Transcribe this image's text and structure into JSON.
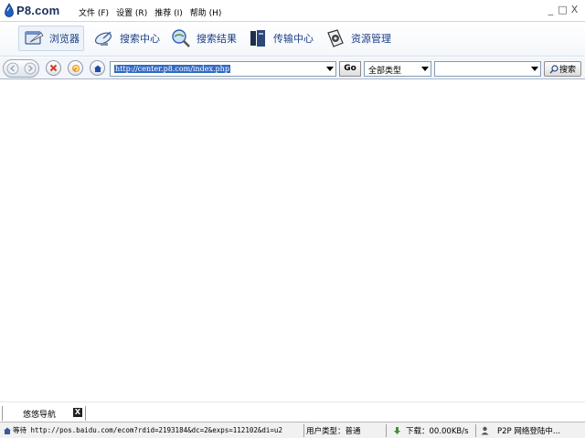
{
  "app": {
    "logo_text": "P8.com"
  },
  "menu": [
    "文件 (F)",
    "设置 (R)",
    "推荐 (I)",
    "帮助 (H)"
  ],
  "window_controls": {
    "minimize": "_",
    "maximize": "□",
    "close": "X"
  },
  "nav_tabs": [
    {
      "label": "浏览器",
      "icon": "browser-icon",
      "active": true
    },
    {
      "label": "搜索中心",
      "icon": "satellite-dish-icon",
      "active": false
    },
    {
      "label": "搜索结果",
      "icon": "magnifier-globe-icon",
      "active": false
    },
    {
      "label": "传输中心",
      "icon": "transfer-icon",
      "active": false
    },
    {
      "label": "资源管理",
      "icon": "resource-film-icon",
      "active": false
    }
  ],
  "address_bar": {
    "url": "http://center.p8.com/index.php",
    "go_label": "Go",
    "type_selected": "全部类型",
    "keyword_value": "",
    "search_label": "搜索"
  },
  "page_tabs": [
    {
      "label": "悠悠导航",
      "close": "X"
    }
  ],
  "status_bar": {
    "loading": "等待 http://pos.baidu.com/ecom?rdid=2193184&dc=2&exps=112102&di=u2",
    "user_type": "用户类型：普通",
    "download": "下载：00.00KB/s",
    "p2p": "P2P 网络登陆中..."
  },
  "colors": {
    "accent": "#1c3f86",
    "selection": "#316ac5",
    "stop": "#d33a2c",
    "refresh": "#f0a020",
    "home": "#1f4aa8"
  }
}
